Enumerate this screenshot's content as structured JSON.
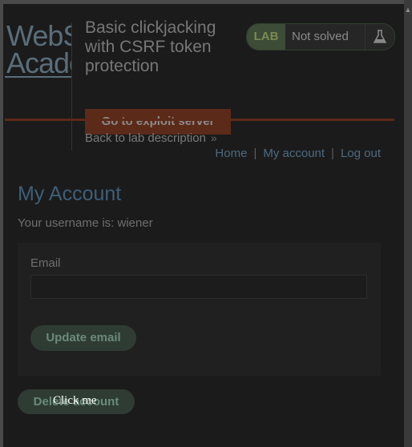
{
  "header": {
    "logo_line1": "WebS",
    "logo_line2": "Acade",
    "lab_title": "Basic clickjacking with CSRF token protection",
    "exploit_button": "Go to exploit server",
    "back_link": "Back to lab description",
    "back_chevron": "»",
    "lab_badge": {
      "label": "LAB",
      "status": "Not solved",
      "icon": "flask-icon"
    }
  },
  "nav": {
    "home": "Home",
    "separator": "|",
    "my_account": "My account",
    "log_out": "Log out"
  },
  "main": {
    "title": "My Account",
    "username_text": "Your username is: wiener",
    "email_label": "Email",
    "email_value": "",
    "update_button": "Update email",
    "delete_button": "Delete account"
  },
  "overlay": {
    "click_me": "Click me"
  },
  "colors": {
    "background": "#1b1b1b",
    "accent_orange": "#5c2a18",
    "link_blue": "#4e6a7f",
    "button_green": "#2e3c34"
  }
}
